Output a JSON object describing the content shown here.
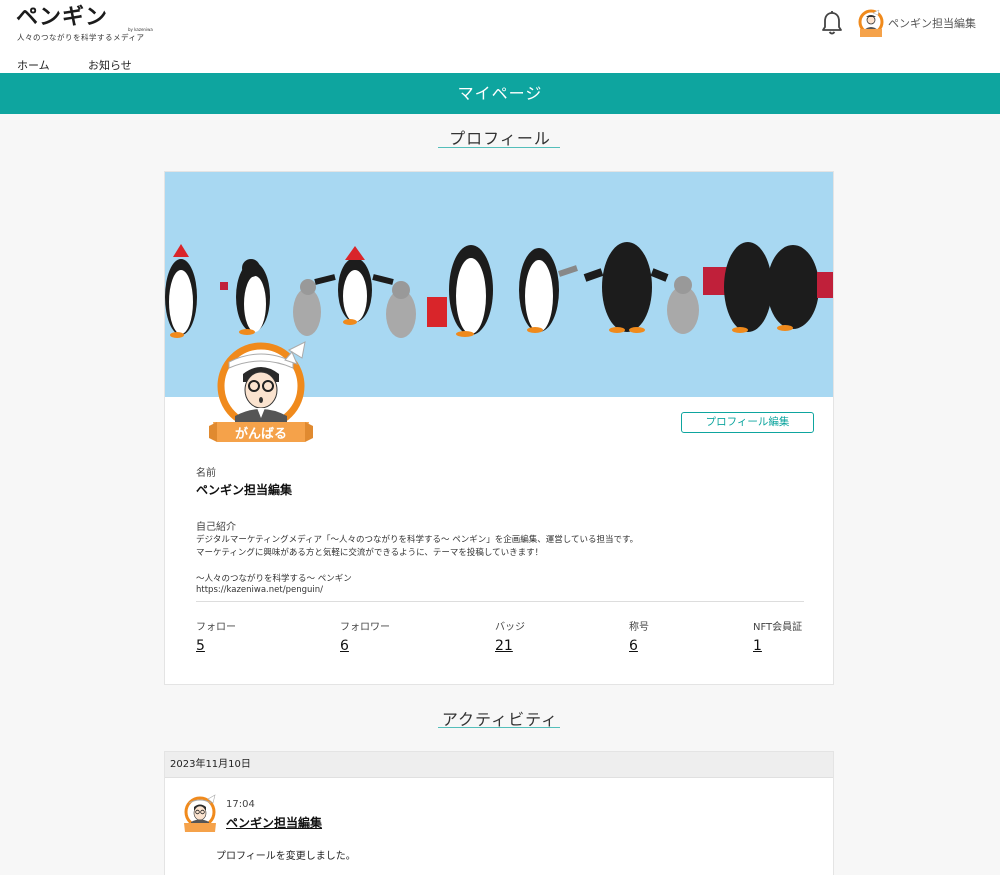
{
  "header": {
    "logo_main": "ペンギン",
    "logo_sub": "by kazeniwa",
    "logo_tagline": "人々のつながりを科学するメディア",
    "user_name": "ペンギン担当編集",
    "nav": [
      {
        "label": "ホーム"
      },
      {
        "label": "お知らせ"
      }
    ]
  },
  "banner": {
    "title": "マイページ"
  },
  "profile": {
    "section_title": "プロフィール",
    "badge_text": "がんばる",
    "edit_button": "プロフィール編集",
    "name_label": "名前",
    "name": "ペンギン担当編集",
    "bio_label": "自己紹介",
    "bio_lines": [
      "デジタルマーケティングメディア「〜人々のつながりを科学する〜 ペンギン」を企画編集、運営している担当です。",
      "マーケティングに興味がある方と気軽に交流ができるように、テーマを投稿していきます！",
      "",
      "〜人々のつながりを科学する〜 ペンギン",
      "https://kazeniwa.net/penguin/"
    ],
    "stats": [
      {
        "label": "フォロー",
        "value": "5"
      },
      {
        "label": "フォロワー",
        "value": "6"
      },
      {
        "label": "バッジ",
        "value": "21"
      },
      {
        "label": "称号",
        "value": "6"
      },
      {
        "label": "NFT会員証",
        "value": "1"
      }
    ]
  },
  "activity": {
    "section_title": "アクティビティ",
    "date": "2023年11月10日",
    "time": "17:04",
    "user": "ペンギン担当編集",
    "text": "プロフィールを変更しました。"
  },
  "colors": {
    "accent": "#0ea59f",
    "cover_sky": "#a8d8f2",
    "badge_orange": "#f08a1c"
  }
}
